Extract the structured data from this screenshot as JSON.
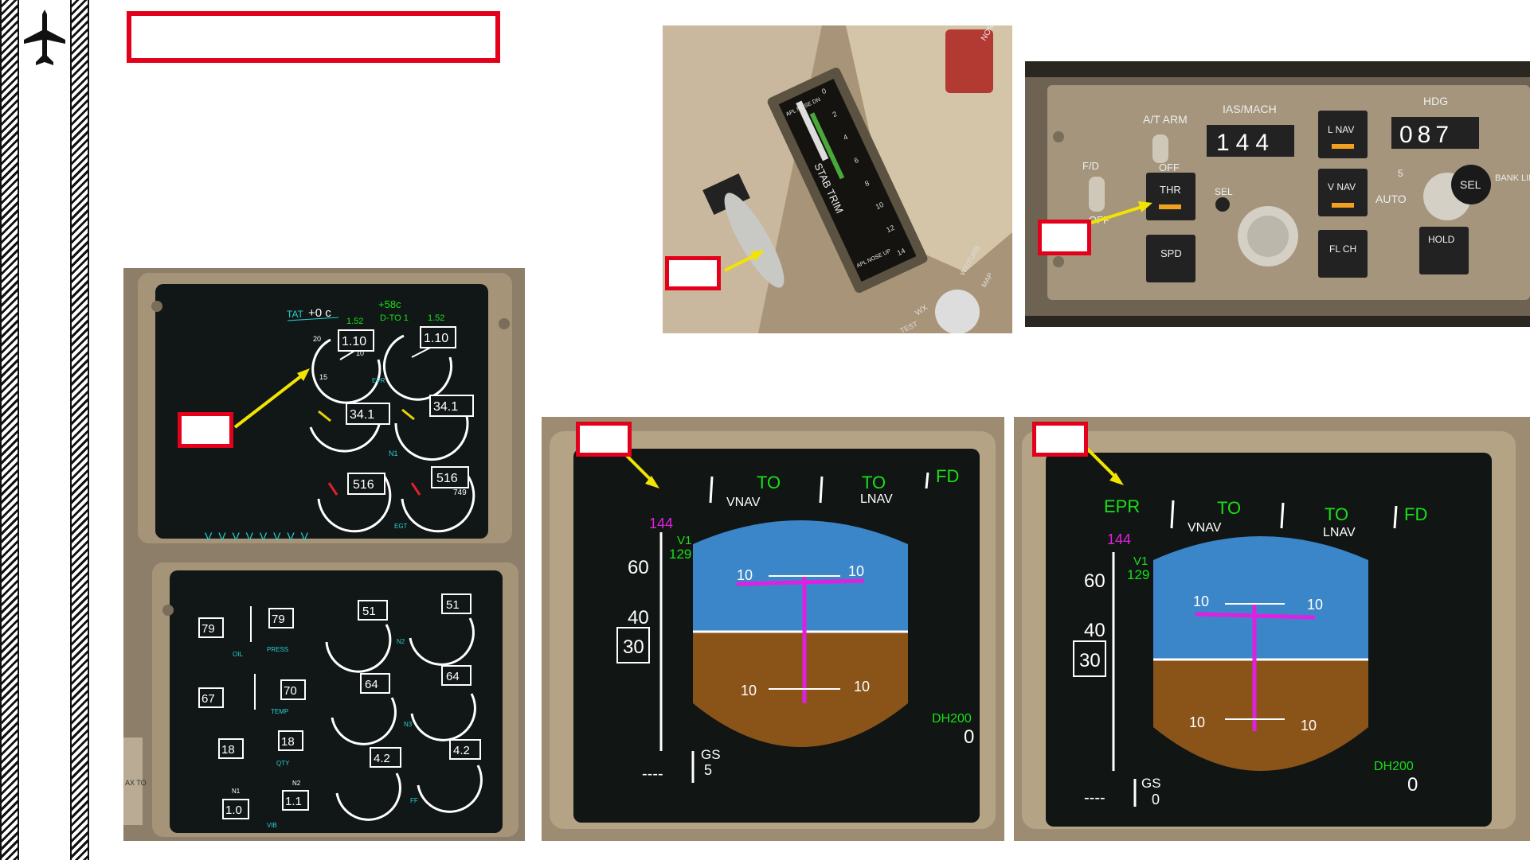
{
  "header": {
    "title": ""
  },
  "callouts": {
    "eicas": "",
    "trim": "",
    "mcp": "",
    "pfd_left": "",
    "pfd_right": ""
  },
  "eicas": {
    "tat_label": "TAT",
    "tat_value": "+0 c",
    "assumed_temp": "+58c",
    "mode": "D-TO 1",
    "epr_ref": [
      "1.52",
      "1.52"
    ],
    "epr": [
      "1.10",
      "1.10"
    ],
    "epr_label": "EPR",
    "epr_ticks": [
      "20",
      "15",
      "10"
    ],
    "n1": [
      "34.1",
      "34.1"
    ],
    "n1_label": "N1",
    "egt": [
      "516",
      "516"
    ],
    "egt_label": "EGT",
    "egt_peak": "749",
    "caution_chevrons": "V V V V V V V V",
    "oil_press": [
      "79",
      "79"
    ],
    "oil_press_label": "PRESS",
    "oil_label": "OIL",
    "oil_temp": [
      "67",
      "70"
    ],
    "oil_temp_label": "TEMP",
    "oil_qty": [
      "18",
      "18"
    ],
    "oil_qty_label": "QTY",
    "vib": [
      "1.0",
      "1.1"
    ],
    "vib_label": "VIB",
    "vib_n1": "N1",
    "vib_n2": "N2",
    "n2": [
      "51",
      "51"
    ],
    "n2_label": "N2",
    "n3": [
      "64",
      "64"
    ],
    "n3_label": "N3",
    "ff": [
      "4.2",
      "4.2"
    ],
    "ff_label": "FF",
    "side_text": "AX\nTO"
  },
  "trim": {
    "scale_label_top": "APL NOSE DN",
    "scale_label": "STAB TRIM",
    "scale_label_bottom": "APL NOSE UP",
    "ticks": [
      "0",
      "2",
      "4",
      "6",
      "8",
      "10",
      "12",
      "14"
    ],
    "norm_label": "NORM",
    "wx_label": "WX",
    "wxturb_label": "WX/TURB",
    "map_label": "MAP",
    "test_label": "TEST"
  },
  "mcp": {
    "at_arm": "A/T ARM",
    "off": "OFF",
    "fd": "F/D",
    "fd_off": "OFF",
    "ias_mach_label": "IAS/MACH",
    "ias_value": "144",
    "sel": "SEL",
    "thr": "THR",
    "spd": "SPD",
    "lnav": "L NAV",
    "vnav": "V NAV",
    "flch": "FL CH",
    "hdg_label": "HDG",
    "hdg_value": "087",
    "auto": "AUTO",
    "hdg_sel": "SEL",
    "hold": "HOLD",
    "bank_limit": "BANK LIMIT",
    "bank_5": "5"
  },
  "pfd_left": {
    "fma_left": "",
    "fma_mid": "TO",
    "fma_right": "TO",
    "fd": "FD",
    "fma_vnav": "VNAV",
    "fma_lnav": "LNAV",
    "sel_speed": "144",
    "v1_label": "V1",
    "v1_value": "129",
    "speed_60": "60",
    "speed_40": "40",
    "speed_current": "30",
    "pitch_10": "10",
    "dh": "DH200",
    "radio_alt": "0",
    "gs_label": "GS",
    "gs_value": "5",
    "gs_dashes": "----"
  },
  "pfd_right": {
    "fma_left": "EPR",
    "fma_mid": "TO",
    "fma_right": "TO",
    "fd": "FD",
    "fma_vnav": "VNAV",
    "fma_lnav": "LNAV",
    "sel_speed": "144",
    "v1_label": "V1",
    "v1_value": "129",
    "speed_60": "60",
    "speed_40": "40",
    "speed_current": "30",
    "pitch_10": "10",
    "dh": "DH200",
    "radio_alt": "0",
    "gs_label": "GS",
    "gs_value": "0",
    "gs_dashes": "----"
  },
  "colors": {
    "callout_red": "#e3001b",
    "arrow_yellow": "#f2e400",
    "eicas_cyan": "#2ad0d0",
    "pfd_green": "#19e019",
    "pfd_magenta": "#e020e0",
    "sky": "#3a86c8",
    "ground": "#8a5418"
  },
  "icons": [
    "airplane-icon"
  ]
}
